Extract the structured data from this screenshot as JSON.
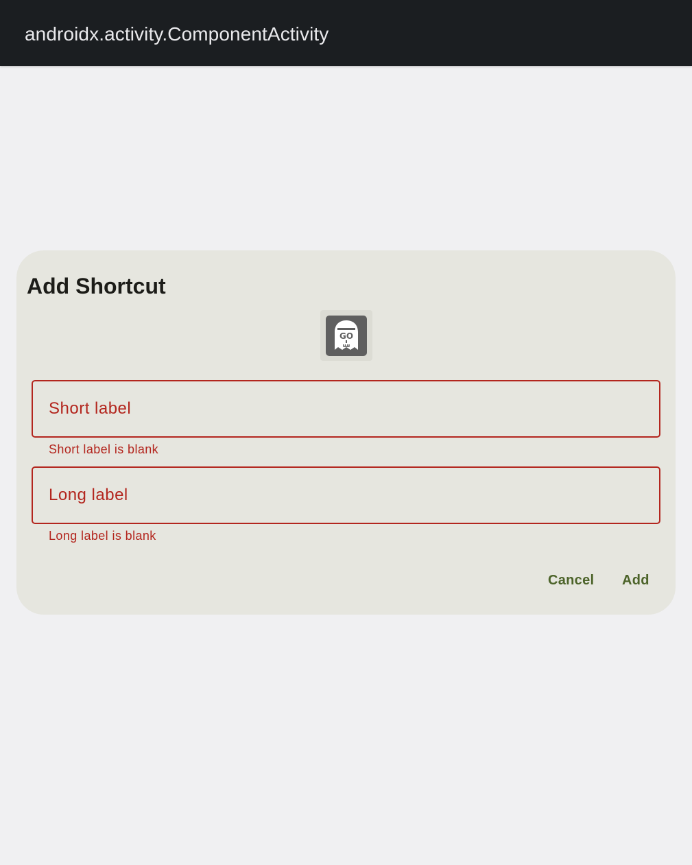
{
  "app_bar": {
    "title": "androidx.activity.ComponentActivity"
  },
  "dialog": {
    "title": "Add Shortcut",
    "icon": "ghost-go-app-icon",
    "fields": [
      {
        "label": "Short label",
        "value": "",
        "error": "Short label is blank"
      },
      {
        "label": "Long label",
        "value": "",
        "error": "Long label is blank"
      }
    ],
    "buttons": {
      "cancel": "Cancel",
      "add": "Add"
    }
  },
  "colors": {
    "app_bar_bg": "#1b1e21",
    "background": "#f0f0f2",
    "dialog_bg": "#e6e6df",
    "error": "#b3261e",
    "button_text": "#4c6329"
  }
}
